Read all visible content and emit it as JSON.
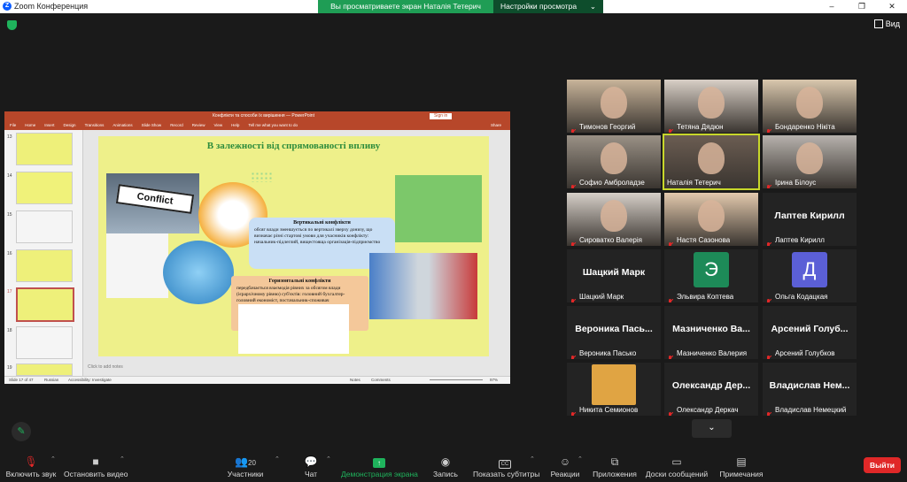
{
  "app": {
    "title": "Zoom Конференция",
    "view_label": "Вид"
  },
  "share_banner": {
    "viewing_text": "Вы просматриваете экран Наталія Тетерич",
    "options_label": "Настройки просмотра"
  },
  "window_controls": [
    "–",
    "❐",
    "✕"
  ],
  "shared_screen": {
    "ppt_title": "Конфлікти та способи їх вирішення — PowerPoint",
    "sign_in": "Sign in",
    "share_btn": "Share",
    "menu": [
      "File",
      "Home",
      "Insert",
      "Design",
      "Transitions",
      "Animations",
      "Slide Show",
      "Record",
      "Review",
      "View",
      "Help",
      "Tell me what you want to do"
    ],
    "thumb_numbers": [
      "13",
      "14",
      "15",
      "16",
      "17",
      "18",
      "19"
    ],
    "slide": {
      "title": "В залежності від спрямованості впливу",
      "conflict_sign": "Conflict",
      "vertical_title": "Вертикальні конфлікти",
      "vertical_text": "обсяг влади зменшується по вертикалі зверху донизу, що визначає різні стартові умови для учасників конфлікту: начальник-підлеглий, вищестояща організація-підприємство",
      "horizontal_title": "Горизонтальні конфлікти",
      "horizontal_text": "передбачається взаємодія рівних за обсягом влади (ієрархічному рівню) суб'єктів: головний бухгалтер-головний економіст, постачальник-споживач"
    },
    "notes": "Click to add notes",
    "status_left": "Slide 17 of 47",
    "status_lang": "Russian",
    "status_access": "Accessibility: Investigate",
    "status_notes": "Notes",
    "status_comments": "Comments",
    "zoom": "97%"
  },
  "participants": [
    {
      "name": "Тимонов Георгий",
      "type": "video",
      "bg": "#c8b49a"
    },
    {
      "name": "Тетяна Дядюн",
      "type": "video",
      "bg": "#d8cfc6"
    },
    {
      "name": "Бондаренко Нікіта",
      "type": "video",
      "bg": "#d9c7ad"
    },
    {
      "name": "Софио Амброладзе",
      "type": "video",
      "bg": "#9a9186"
    },
    {
      "name": "Наталія Тетерич",
      "type": "video",
      "bg": "#6b5d52",
      "active": true,
      "nomic": true
    },
    {
      "name": "Ірина Білоус",
      "type": "video",
      "bg": "#b7b2ad"
    },
    {
      "name": "Сироватко Валерія",
      "type": "video",
      "bg": "#d6cfc8"
    },
    {
      "name": "Настя Сазонова",
      "type": "video",
      "bg": "#e3c9ad"
    },
    {
      "name": "Лаптев Кирилл",
      "type": "text",
      "big": "Лаптев Кирилл"
    },
    {
      "name": "Шацкий Марк",
      "type": "text",
      "big": "Шацкий Марк"
    },
    {
      "name": "Эльвира Коптева",
      "type": "avatar",
      "letter": "Э",
      "color": "#1d8a58"
    },
    {
      "name": "Ольга Кодацкая",
      "type": "avatar",
      "letter": "Д",
      "color": "#5b5fd6"
    },
    {
      "name": "Вероника Пасько",
      "type": "text",
      "big": "Вероника Пась..."
    },
    {
      "name": "Мазниченко Валерия",
      "type": "text",
      "big": "Мазниченко Ва..."
    },
    {
      "name": "Арсений Голубков",
      "type": "text",
      "big": "Арсений Голуб..."
    },
    {
      "name": "Никита Семионов",
      "type": "photo",
      "bg": "#e0a443"
    },
    {
      "name": "Олександр Деркач",
      "type": "text",
      "big": "Олександр Дер..."
    },
    {
      "name": "Владислав Немецкий",
      "type": "text",
      "big": "Владислав Нем..."
    }
  ],
  "toolbar": {
    "mute": "Включить звук",
    "video": "Остановить видео",
    "participants": "Участники",
    "participants_count": "20",
    "chat": "Чат",
    "share": "Демонстрация экрана",
    "record": "Запись",
    "captions": "Показать субтитры",
    "reactions": "Реакции",
    "apps": "Приложения",
    "whiteboards": "Доски сообщений",
    "notes": "Примечания",
    "leave": "Выйти"
  },
  "colors": {
    "accent_green": "#1fb35c",
    "leave_red": "#e02828",
    "ppt_red": "#b7472a",
    "active_speaker": "#c8d72a"
  }
}
